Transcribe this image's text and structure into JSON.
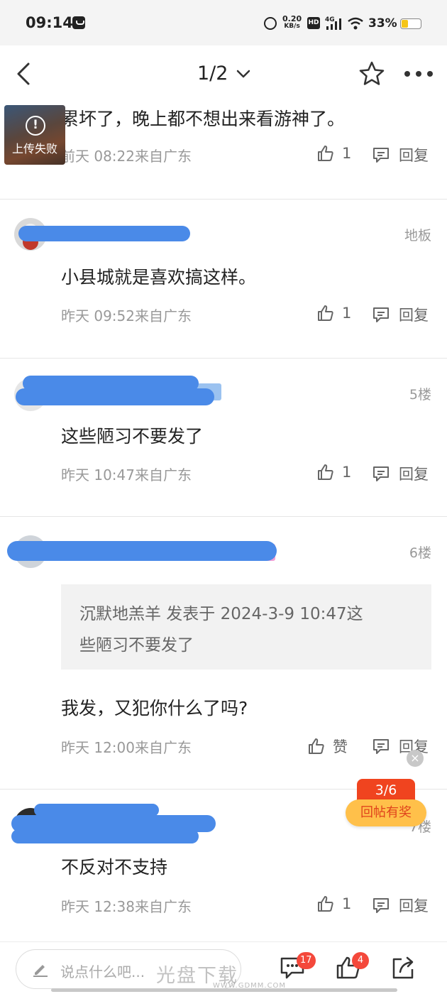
{
  "status_bar": {
    "time": "09:14",
    "net_speed": "0.20",
    "net_unit": "KB/s",
    "hd": "HD",
    "network": "4G",
    "battery": "33%",
    "battery_level": 0.33,
    "battery_color": "#f5c518"
  },
  "nav": {
    "page_indicator": "1/2",
    "icons": [
      "back-icon",
      "chevron-down-icon",
      "star-icon",
      "more-icon"
    ]
  },
  "posts": [
    {
      "floor": "",
      "content": "累坏了，晚上都不想出来看游神了。",
      "time": "前天 08:22来自广东",
      "likes": "1",
      "reply": "回复",
      "thumbnail_label": "上传失败",
      "thumbnail_icon": "!"
    },
    {
      "floor": "地板",
      "content": "小县城就是喜欢搞这样。",
      "time": "昨天 09:52来自广东",
      "likes": "1",
      "reply": "回复"
    },
    {
      "floor": "5楼",
      "content": "这些陋习不要发了",
      "time": "昨天 10:47来自广东",
      "likes": "1",
      "reply": "回复"
    },
    {
      "floor": "6楼",
      "quote_line1": "沉默地羔羊 发表于 2024-3-9 10:47这",
      "quote_line2": "些陋习不要发了",
      "content": "我发，又犯你什么了吗?",
      "time": "昨天 12:00来自广东",
      "likes": "赞",
      "reply": "回复"
    },
    {
      "floor": "7楼",
      "content": "不反对不支持",
      "time": "昨天 12:38来自广东",
      "likes": "1",
      "reply": "回复"
    }
  ],
  "reward": {
    "close": "×",
    "progress": "3/6",
    "label": "回帖有奖"
  },
  "bottom_bar": {
    "placeholder": "说点什么吧...",
    "comment_count": "17",
    "like_count": "4"
  },
  "watermark": {
    "text": "光盘下载",
    "url": "WWW.GDMM.COM"
  },
  "colors": {
    "accent_red": "#f0441f",
    "reward_yellow": "#ffc04a",
    "redaction_blue": "#4a8ae8"
  }
}
